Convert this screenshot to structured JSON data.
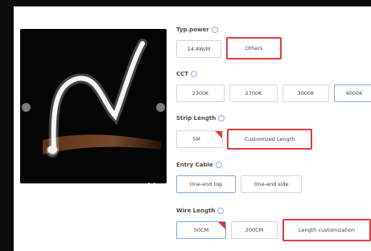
{
  "gallery": {
    "image_alt": "LED neon strip product photo",
    "prev_icon": "chevron-left-icon",
    "next_icon": "chevron-right-icon",
    "more_icon": "more-icon",
    "more_glyph": "••"
  },
  "typ_power": {
    "label": "Typ.power",
    "options": [
      {
        "label": "14.4W/M",
        "selected": false
      },
      {
        "label": "Others",
        "selected": true
      }
    ]
  },
  "cct": {
    "label": "CCT",
    "options": [
      {
        "label": "2300K",
        "selected": false
      },
      {
        "label": "2700K",
        "selected": false
      },
      {
        "label": "3000K",
        "selected": false
      },
      {
        "label": "4000K",
        "selected": true
      }
    ]
  },
  "strip_length": {
    "label": "Strip Length",
    "options": [
      {
        "label": "5M",
        "selected": false
      },
      {
        "label": "Customized Length",
        "selected": true
      }
    ]
  },
  "entry_cable": {
    "label": "Entry Cable",
    "options": [
      {
        "label": "One-end top",
        "selected": true
      },
      {
        "label": "One-end side",
        "selected": false
      }
    ]
  },
  "wire_length": {
    "label": "Wire Length",
    "options": [
      {
        "label": "50CM",
        "selected": true
      },
      {
        "label": "200CM",
        "selected": false
      },
      {
        "label": "Length customization",
        "selected": false
      }
    ]
  },
  "colors": {
    "highlight_red": "#e23b3b",
    "selected_blue": "#7fa7e2"
  }
}
